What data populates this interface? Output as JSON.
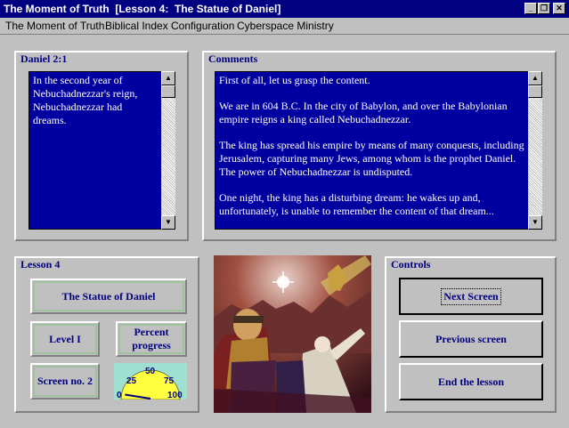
{
  "window": {
    "title": "The Moment of Truth  [Lesson 4:  The Statue of Daniel]",
    "buttons": {
      "minimize": "_",
      "restore": "❐",
      "close": "✕"
    }
  },
  "menu": [
    "The Moment of Truth",
    "Biblical Index",
    "Configuration",
    "Cyberspace Ministry"
  ],
  "verse_panel": {
    "title": "Daniel 2:1",
    "text": "In the second year of Nebuchadnezzar's reign, Nebuchadnezzar had dreams."
  },
  "comments_panel": {
    "title": "Comments",
    "paragraphs": [
      "First of all, let us grasp the content.",
      "We are in 604 B.C. In the city of Babylon, and over the Babylonian empire reigns a king called Nebuchadnezzar.",
      "The king has spread his empire by means of many conquests, including Jerusalem, capturing many Jews, among whom is the prophet Daniel. The power of Nebuchadnezzar is undisputed.",
      "One night, the king has a disturbing dream: he wakes up and, unfortunately, is unable to remember the content of that dream..."
    ]
  },
  "lesson_panel": {
    "title": "Lesson 4",
    "lesson_name": "The Statue of Daniel",
    "level": "Level I",
    "progress_label": "Percent progress",
    "screen": "Screen no. 2",
    "gauge": {
      "ticks": [
        "25",
        "50",
        "75",
        "0",
        "100"
      ],
      "progress_percent": 5
    }
  },
  "controls_panel": {
    "title": "Controls",
    "next": "Next Screen",
    "previous": "Previous screen",
    "end": "End the lesson"
  },
  "colors": {
    "title_bar": "#000080",
    "text_background": "#0000a0",
    "label_text": "#000080",
    "gauge_background": "#9fe0d0"
  },
  "icons": {
    "scroll_up": "triangle-up",
    "scroll_down": "triangle-down"
  }
}
